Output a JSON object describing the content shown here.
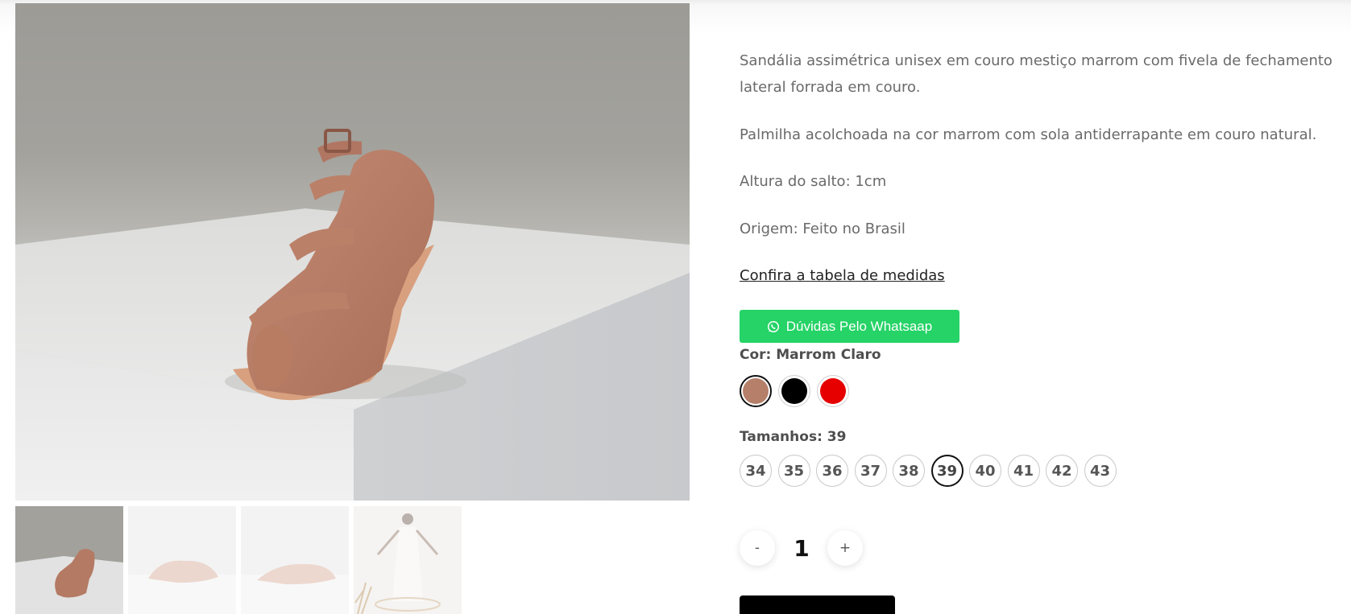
{
  "product": {
    "description": [
      "Sandália assimétrica unisex em couro mestiço marrom com fivela de fechamento lateral forrada em couro.",
      "Palmilha acolchoada na cor marrom com sola antiderrapante em couro natural.",
      "Altura do salto: 1cm",
      "Origem: Feito no Brasil"
    ],
    "size_chart_link": "Confira a tabela de medidas",
    "whatsapp_button": {
      "label": "Dúvidas Pelo Whatsaap",
      "icon": "whatsapp-icon",
      "color": "#25d366"
    }
  },
  "gallery": {
    "thumbnails": [
      {
        "name": "thumbnail-1",
        "active": true
      },
      {
        "name": "thumbnail-2",
        "active": false
      },
      {
        "name": "thumbnail-3",
        "active": false
      },
      {
        "name": "thumbnail-4",
        "active": false
      }
    ]
  },
  "color_option": {
    "label": "Cor: Marrom Claro",
    "swatches": [
      {
        "name": "Marrom Claro",
        "hex": "#b57f6a",
        "selected": true
      },
      {
        "name": "Preto",
        "hex": "#000000",
        "selected": false
      },
      {
        "name": "Vermelho",
        "hex": "#e60000",
        "selected": false
      }
    ]
  },
  "size_option": {
    "label": "Tamanhos: 39",
    "sizes": [
      "34",
      "35",
      "36",
      "37",
      "38",
      "39",
      "40",
      "41",
      "42",
      "43"
    ],
    "selected": "39"
  },
  "quantity": {
    "minus": "-",
    "value": "1",
    "plus": "+"
  }
}
